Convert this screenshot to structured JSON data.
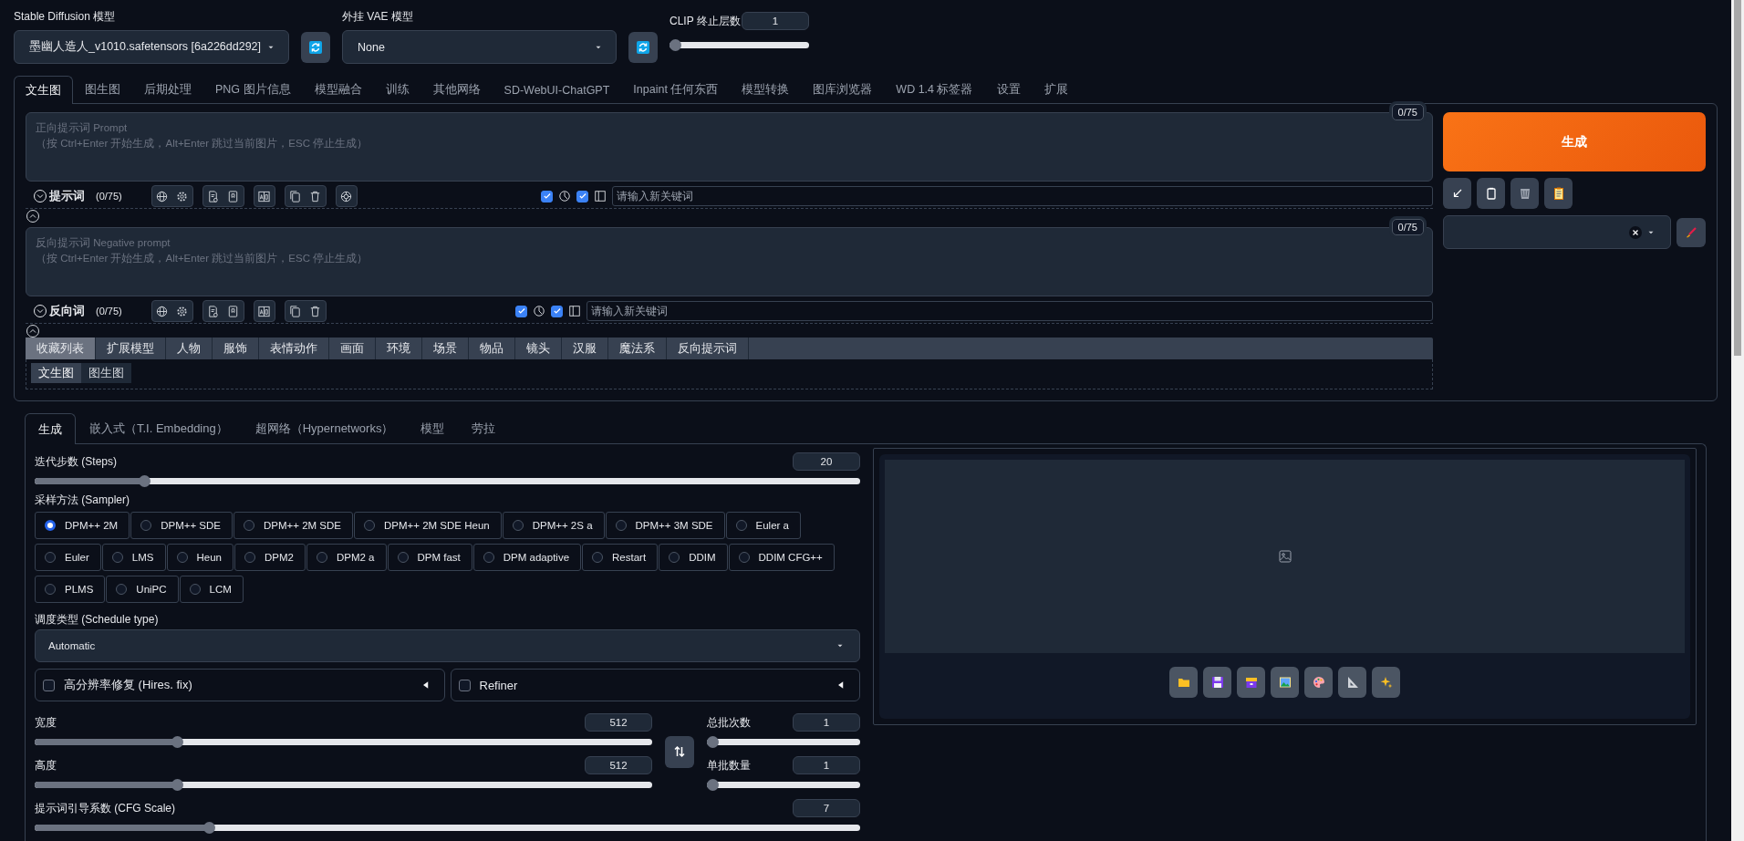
{
  "top": {
    "model_label": "Stable Diffusion 模型",
    "model_value": "墨幽人造人_v1010.safetensors [6a226dd292]",
    "vae_label": "外挂 VAE 模型",
    "vae_value": "None",
    "clip_label": "CLIP 终止层数",
    "clip_value": "1"
  },
  "clip_slider": {
    "level": 0
  },
  "tabs": [
    {
      "label": "文生图",
      "selected": true
    },
    {
      "label": "图生图",
      "selected": false
    },
    {
      "label": "后期处理",
      "selected": false
    },
    {
      "label": "PNG 图片信息",
      "selected": false
    },
    {
      "label": "模型融合",
      "selected": false
    },
    {
      "label": "训练",
      "selected": false
    },
    {
      "label": "其他网络",
      "selected": false
    },
    {
      "label": "SD-WebUI-ChatGPT",
      "selected": false
    },
    {
      "label": "Inpaint 任何东西",
      "selected": false
    },
    {
      "label": "模型转换",
      "selected": false
    },
    {
      "label": "图库浏览器",
      "selected": false
    },
    {
      "label": "WD 1.4 标签器",
      "selected": false
    },
    {
      "label": "设置",
      "selected": false
    },
    {
      "label": "扩展",
      "selected": false
    }
  ],
  "prompts": [
    {
      "token_count": "0/75",
      "placeholder": "正向提示词 Prompt\n（按 Ctrl+Enter 开始生成，Alt+Enter 跳过当前图片，ESC 停止生成）",
      "title": "提示词",
      "count": "(0/75)",
      "checkboxes": [
        {
          "checked": true
        },
        {
          "checked": true
        }
      ],
      "keyword_placeholder": "请输入新关键词"
    },
    {
      "token_count": "0/75",
      "placeholder": "反向提示词 Negative prompt\n（按 Ctrl+Enter 开始生成，Alt+Enter 跳过当前图片，ESC 停止生成）",
      "title": "反向词",
      "count": "(0/75)",
      "checkboxes": [
        {
          "checked": true
        },
        {
          "checked": true
        }
      ],
      "keyword_placeholder": "请输入新关键词"
    }
  ],
  "categories": [
    {
      "label": "收藏列表",
      "selected": true
    },
    {
      "label": "扩展模型",
      "selected": false
    },
    {
      "label": "人物",
      "selected": false
    },
    {
      "label": "服饰",
      "selected": false
    },
    {
      "label": "表情动作",
      "selected": false
    },
    {
      "label": "画面",
      "selected": false
    },
    {
      "label": "环境",
      "selected": false
    },
    {
      "label": "场景",
      "selected": false
    },
    {
      "label": "物品",
      "selected": false
    },
    {
      "label": "镜头",
      "selected": false
    },
    {
      "label": "汉服",
      "selected": false
    },
    {
      "label": "魔法系",
      "selected": false
    },
    {
      "label": "反向提示词",
      "selected": false
    }
  ],
  "sub_tabs": [
    {
      "label": "文生图",
      "selected": true
    },
    {
      "label": "图生图",
      "selected": false
    }
  ],
  "generate_button": "生成",
  "lower_tabs": [
    {
      "label": "生成",
      "selected": true
    },
    {
      "label": "嵌入式（T.I. Embedding）",
      "selected": false
    },
    {
      "label": "超网络（Hypernetworks）",
      "selected": false
    },
    {
      "label": "模型",
      "selected": false
    },
    {
      "label": "劳拉",
      "selected": false
    }
  ],
  "steps": {
    "label": "迭代步数 (Steps)",
    "value": "20",
    "level": 0.128
  },
  "sampler": {
    "label": "采样方法 (Sampler)",
    "options": [
      {
        "label": "DPM++ 2M",
        "selected": true
      },
      {
        "label": "DPM++ SDE",
        "selected": false
      },
      {
        "label": "DPM++ 2M SDE",
        "selected": false
      },
      {
        "label": "DPM++ 2M SDE Heun",
        "selected": false
      },
      {
        "label": "DPM++ 2S a",
        "selected": false
      },
      {
        "label": "DPM++ 3M SDE",
        "selected": false
      },
      {
        "label": "Euler a",
        "selected": false
      },
      {
        "label": "Euler",
        "selected": false
      },
      {
        "label": "LMS",
        "selected": false
      },
      {
        "label": "Heun",
        "selected": false
      },
      {
        "label": "DPM2",
        "selected": false
      },
      {
        "label": "DPM2 a",
        "selected": false
      },
      {
        "label": "DPM fast",
        "selected": false
      },
      {
        "label": "DPM adaptive",
        "selected": false
      },
      {
        "label": "Restart",
        "selected": false
      },
      {
        "label": "DDIM",
        "selected": false
      },
      {
        "label": "DDIM CFG++",
        "selected": false
      },
      {
        "label": "PLMS",
        "selected": false
      },
      {
        "label": "UniPC",
        "selected": false
      },
      {
        "label": "LCM",
        "selected": false
      }
    ]
  },
  "schedule": {
    "label": "调度类型 (Schedule type)",
    "value": "Automatic"
  },
  "accordions": [
    {
      "label": "高分辨率修复 (Hires. fix)",
      "checked": false
    },
    {
      "label": "Refiner",
      "checked": false
    }
  ],
  "size_sliders": [
    {
      "label": "宽度",
      "value": "512",
      "level": 0.226
    },
    {
      "label": "高度",
      "value": "512",
      "level": 0.226
    }
  ],
  "batch_sliders": [
    {
      "label": "总批次数",
      "value": "1",
      "level": 0
    },
    {
      "label": "单批数量",
      "value": "1",
      "level": 0
    }
  ],
  "cfg": {
    "label": "提示词引导系数 (CFG Scale)",
    "value": "7",
    "level": 0.207
  }
}
